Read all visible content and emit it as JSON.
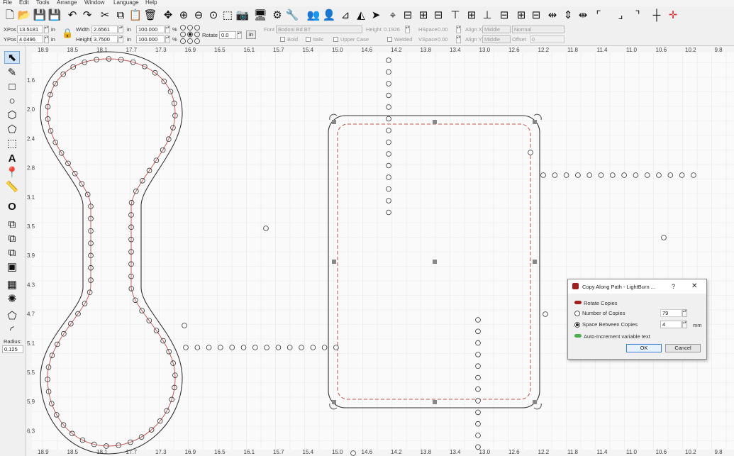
{
  "menu": [
    "File",
    "Edit",
    "Tools",
    "Arrange",
    "Window",
    "Language",
    "Help"
  ],
  "toolbar_icons": [
    "new-file",
    "open-folder",
    "save",
    "save-as",
    "undo",
    "redo",
    "cut",
    "copy",
    "paste",
    "delete",
    "move",
    "zoom-in",
    "zoom-out",
    "zoom-frame",
    "camera",
    "monitor",
    "settings",
    "tools",
    "group",
    "user",
    "mirror-h",
    "mirror-v",
    "send-job",
    "target",
    "align-left",
    "align-center",
    "align-right",
    "align-top",
    "align-middle",
    "align-bottom",
    "distribute-h",
    "distribute-v",
    "corner-tl",
    "corner-tr",
    "center-cross",
    "red-cross"
  ],
  "props": {
    "xpos_label": "XPos",
    "xpos_value": "13.5181",
    "ypos_label": "YPos",
    "ypos_value": "4.0496",
    "unit_in": "in",
    "width_label": "Width",
    "width_value": "2.6561",
    "height_label": "Height",
    "height_value": "3.7500",
    "scale_w": "100.000",
    "scale_h": "100.000",
    "percent": "%",
    "rotate_label": "Rotate",
    "rotate_value": "0.0",
    "rotate_unit": "in",
    "font_label": "Font",
    "font_value": "Bodoni Bd BT",
    "theight_label": "Height",
    "theight_value": "0.1926",
    "hspace_label": "HSpace",
    "hspace_value": "0.00",
    "vspace_label": "VSpace",
    "vspace_value": "0.00",
    "alignx_label": "Align X",
    "alignx_value": "Middle",
    "aligny_label": "Align Y",
    "aligny_value": "Middle",
    "normal_value": "Normal",
    "offset_label": "Offset",
    "offset_value": "0",
    "bold": "Bold",
    "italic": "Italic",
    "uppercase": "Upper Case",
    "welded": "Welded"
  },
  "left_tools": [
    "select",
    "edit-nodes",
    "rectangle",
    "ellipse",
    "polygon",
    "pentagon",
    "frame",
    "text",
    "position",
    "measure",
    "offset",
    "weld",
    "boolean-union",
    "boolean-subtract",
    "boolean-intersect",
    "array-grid",
    "circular-array",
    "path",
    "corner"
  ],
  "radius_label": "Radius:",
  "radius_value": "0.125",
  "ruler_top": [
    "18.9",
    "18.5",
    "18.1",
    "17.7",
    "17.3",
    "16.9",
    "16.5",
    "16.1",
    "15.7",
    "15.4",
    "15.0",
    "14.6",
    "14.2",
    "13.8",
    "13.4",
    "13.0",
    "12.6",
    "12.2",
    "11.8",
    "11.4",
    "11.0",
    "10.6",
    "10.2",
    "9.8"
  ],
  "ruler_left": [
    "1.6",
    "2.0",
    "2.4",
    "2.8",
    "3.1",
    "3.5",
    "3.9",
    "4.3",
    "4.7",
    "5.1",
    "5.5",
    "5.9",
    "6.3"
  ],
  "dialog": {
    "title": "Copy Along Path - LightBurn ...",
    "help": "?",
    "close": "✕",
    "rotate_copies": "Rotate Copies",
    "number_of_copies_label": "Number of Copies",
    "number_of_copies_value": "79",
    "space_label": "Space Between Copies",
    "space_value": "4",
    "space_unit": "mm",
    "auto_increment": "Auto-Increment variable text",
    "ok": "OK",
    "cancel": "Cancel"
  },
  "colors": {
    "accent": "#c0504d",
    "toggle_on": "#4caf50",
    "toggle_red": "#a02020",
    "handle": "#888888",
    "shape_stroke": "#333333"
  }
}
